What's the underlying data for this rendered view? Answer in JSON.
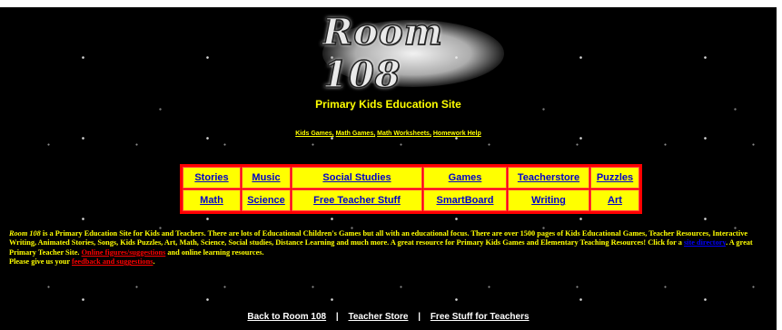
{
  "logo": {
    "text": "Room 108"
  },
  "subtitle": "Primary Kids Education Site",
  "top_links": [
    "Kids Games,",
    "Math Games,",
    "Math Worksheets,",
    "Homework Help"
  ],
  "nav": {
    "row1": [
      "Stories",
      "Music",
      "Social Studies",
      "Games",
      "Teacherstore",
      "Puzzles"
    ],
    "row2": [
      "Math",
      "Science",
      "Free Teacher Stuff",
      "SmartBoard",
      "Writing",
      "Art"
    ]
  },
  "description": {
    "brand": "Room 108",
    "part1": " is a Primary Education Site for Kids and Teachers.   There are lots of Educational Children's Games but all with an educational focus. There are over 1500 pages of Kids Educational Games, Teacher Resources, Interactive Writing, Animated Stories, Songs, Kids Puzzles, Art, Math, Science, Social studies, Distance Learning and much more. A great resource for Primary Kids Games and Elementary Teaching Resources! Click for a ",
    "site_directory_link": "site directory",
    "part2": ".  A great Primary Teacher Site.  ",
    "online_link": "Online figures/suggestions",
    "part3": " and online learning resources.",
    "part4": "Please give us your ",
    "feedback_link": "feedback and suggestions",
    "part5": "."
  },
  "footer": {
    "links": [
      "Back to Room 108",
      "Teacher Store",
      "Free Stuff for Teachers"
    ],
    "separator": "|"
  },
  "colors": {
    "background": "#000000",
    "accent_yellow": "#ffff00",
    "border_red": "#ff0000",
    "link_blue": "#0000cc"
  }
}
